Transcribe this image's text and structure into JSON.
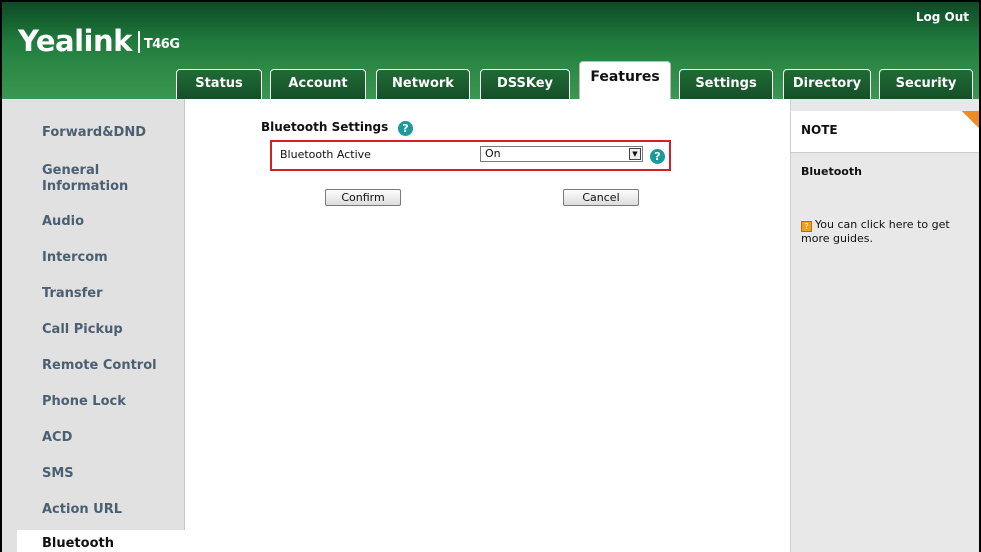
{
  "header": {
    "brand": "Yealink",
    "model": "T46G",
    "logout_label": "Log Out"
  },
  "tabs": [
    {
      "label": "Status"
    },
    {
      "label": "Account"
    },
    {
      "label": "Network"
    },
    {
      "label": "DSSKey"
    },
    {
      "label": "Features",
      "active": true
    },
    {
      "label": "Settings"
    },
    {
      "label": "Directory"
    },
    {
      "label": "Security"
    }
  ],
  "sidebar": {
    "items": [
      {
        "label": "Forward&DND"
      },
      {
        "label": "General Information"
      },
      {
        "label": "Audio"
      },
      {
        "label": "Intercom"
      },
      {
        "label": "Transfer"
      },
      {
        "label": "Call Pickup"
      },
      {
        "label": "Remote Control"
      },
      {
        "label": "Phone Lock"
      },
      {
        "label": "ACD"
      },
      {
        "label": "SMS"
      },
      {
        "label": "Action URL"
      },
      {
        "label": "Bluetooth",
        "active": true
      }
    ]
  },
  "main": {
    "section_title": "Bluetooth Settings",
    "bluetooth_active_label": "Bluetooth Active",
    "bluetooth_active_value": "On",
    "confirm_label": "Confirm",
    "cancel_label": "Cancel"
  },
  "note": {
    "title": "NOTE",
    "subtitle": "Bluetooth",
    "text": "You can click here to get more guides."
  },
  "colors": {
    "header_green": "#1f7a3c",
    "sidebar_text": "#4a5f72",
    "highlight_red": "#d62020",
    "help_teal": "#1a9a9a",
    "note_orange": "#f08a24"
  }
}
